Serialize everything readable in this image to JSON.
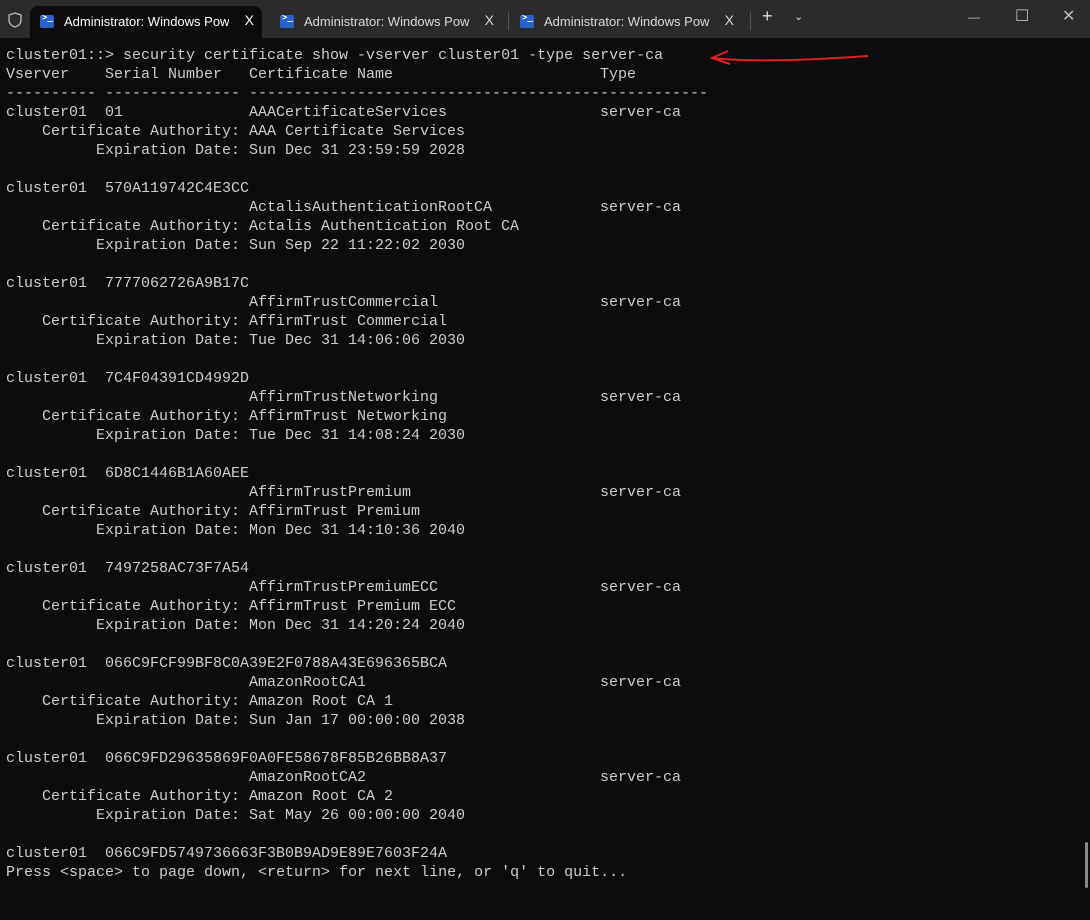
{
  "tabs": [
    {
      "title": "Administrator: Windows PowerShell",
      "close": "X",
      "active": true
    },
    {
      "title": "Administrator: Windows PowerShell",
      "close": "X",
      "active": false
    },
    {
      "title": "Administrator: Windows PowerShell",
      "close": "X",
      "active": false
    }
  ],
  "titlebar": {
    "new_tab": "+",
    "dropdown": "⌄",
    "minimize": "—",
    "maximize": "☐",
    "close": "✕"
  },
  "terminal": {
    "command": "cluster01::> security certificate show -vserver cluster01 -type server-ca",
    "headers": {
      "vserver": "Vserver",
      "serial": "Serial Number",
      "name": "Certificate Name",
      "type": "Type"
    },
    "separators": {
      "vserver": "----------",
      "serial": "---------------",
      "name": "---------------------------------------",
      "type": "------------"
    },
    "ca_label": "Certificate Authority:",
    "exp_label": "Expiration Date:",
    "certificates": [
      {
        "vserver": "cluster01",
        "serial": "01",
        "name": "AAACertificateServices",
        "type": "server-ca",
        "authority": "AAA Certificate Services",
        "expiration": "Sun Dec 31 23:59:59 2028"
      },
      {
        "vserver": "cluster01",
        "serial": "570A119742C4E3CC",
        "name": "ActalisAuthenticationRootCA",
        "type": "server-ca",
        "authority": "Actalis Authentication Root CA",
        "expiration": "Sun Sep 22 11:22:02 2030"
      },
      {
        "vserver": "cluster01",
        "serial": "7777062726A9B17C",
        "name": "AffirmTrustCommercial",
        "type": "server-ca",
        "authority": "AffirmTrust Commercial",
        "expiration": "Tue Dec 31 14:06:06 2030"
      },
      {
        "vserver": "cluster01",
        "serial": "7C4F04391CD4992D",
        "name": "AffirmTrustNetworking",
        "type": "server-ca",
        "authority": "AffirmTrust Networking",
        "expiration": "Tue Dec 31 14:08:24 2030"
      },
      {
        "vserver": "cluster01",
        "serial": "6D8C1446B1A60AEE",
        "name": "AffirmTrustPremium",
        "type": "server-ca",
        "authority": "AffirmTrust Premium",
        "expiration": "Mon Dec 31 14:10:36 2040"
      },
      {
        "vserver": "cluster01",
        "serial": "7497258AC73F7A54",
        "name": "AffirmTrustPremiumECC",
        "type": "server-ca",
        "authority": "AffirmTrust Premium ECC",
        "expiration": "Mon Dec 31 14:20:24 2040"
      },
      {
        "vserver": "cluster01",
        "serial": "066C9FCF99BF8C0A39E2F0788A43E696365BCA",
        "name": "AmazonRootCA1",
        "type": "server-ca",
        "authority": "Amazon Root CA 1",
        "expiration": "Sun Jan 17 00:00:00 2038"
      },
      {
        "vserver": "cluster01",
        "serial": "066C9FD29635869F0A0FE58678F85B26BB8A37",
        "name": "AmazonRootCA2",
        "type": "server-ca",
        "authority": "Amazon Root CA 2",
        "expiration": "Sat May 26 00:00:00 2040"
      }
    ],
    "partial": {
      "vserver": "cluster01",
      "serial": "066C9FD5749736663F3B0B9AD9E89E7603F24A"
    },
    "pager_prompt": "Press <space> to page down, <return> for next line, or 'q' to quit..."
  },
  "annotation_color": "#e0201c"
}
